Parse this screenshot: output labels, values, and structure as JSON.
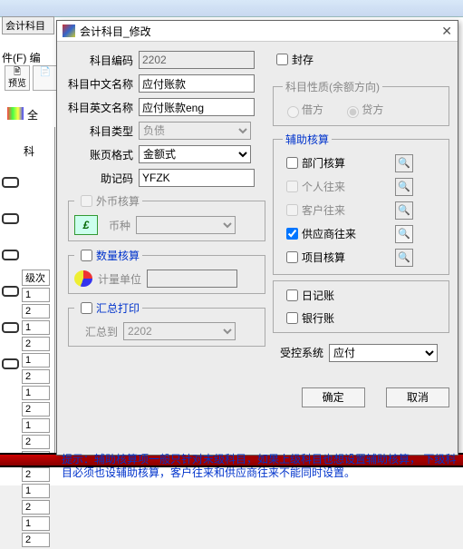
{
  "bg": {
    "tab": "会计科目",
    "menu": "件(F)  编",
    "prev": "预览",
    "full": "全",
    "heading": "科",
    "col1": "级次"
  },
  "title": "会计科目_修改",
  "labels": {
    "code": "科目编码",
    "cname": "科目中文名称",
    "ename": "科目英文名称",
    "type": "科目类型",
    "pagefmt": "账页格式",
    "mnemonic": "助记码",
    "seal": "封存",
    "nature_grp": "科目性质(余额方向)",
    "debit": "借方",
    "credit": "贷方",
    "aux_grp": "辅助核算",
    "dept": "部门核算",
    "person": "个人往来",
    "cust": "客户往来",
    "supplier": "供应商往来",
    "project": "项目核算",
    "fc_grp": "外币核算",
    "currency": "币种",
    "qty_grp": "数量核算",
    "unit": "计量单位",
    "sum_grp": "汇总打印",
    "sumto": "汇总到",
    "daybook": "日记账",
    "bankbook": "银行账",
    "ctrlsys": "受控系统"
  },
  "values": {
    "code": "2202",
    "cname": "应付账款",
    "ename": "应付账款eng",
    "type": "负债",
    "pagefmt": "金额式",
    "mnemonic": "YFZK",
    "sumto": "2202",
    "ctrlsys": "应付"
  },
  "buttons": {
    "ok": "确定",
    "cancel": "取消"
  },
  "hint": "提示：辅助核算项一般只针对末级科目，如果上级科目也想设置辅助核算，\n下级科目必须也设辅助核算，客户往来和供应商往来不能同时设置。"
}
